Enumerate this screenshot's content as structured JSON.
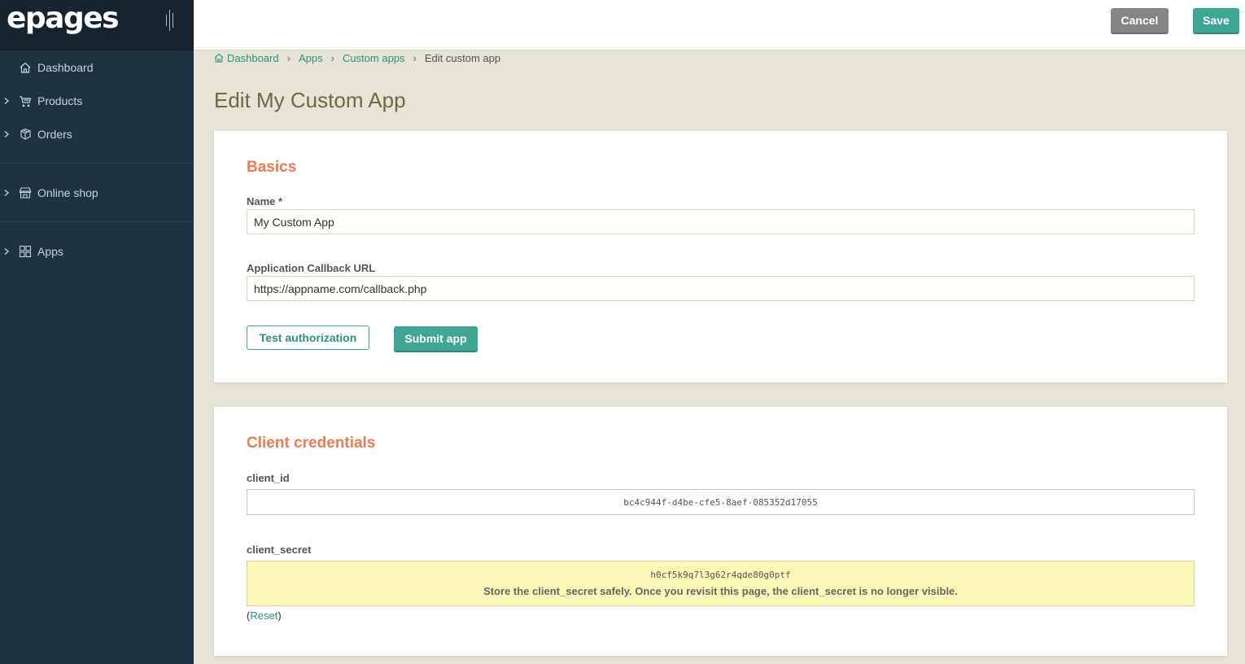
{
  "brand": {
    "logo": "epages"
  },
  "sidebar": {
    "items": [
      {
        "label": "Dashboard",
        "icon": "home-icon",
        "expandable": false
      },
      {
        "label": "Products",
        "icon": "cart-icon",
        "expandable": true
      },
      {
        "label": "Orders",
        "icon": "orders-icon",
        "expandable": true
      },
      {
        "label": "Online shop",
        "icon": "store-icon",
        "expandable": true
      },
      {
        "label": "Apps",
        "icon": "apps-grid-icon",
        "expandable": true
      }
    ]
  },
  "header": {
    "cancel_label": "Cancel",
    "save_label": "Save"
  },
  "breadcrumb": {
    "items": [
      "Dashboard",
      "Apps",
      "Custom apps"
    ],
    "current": "Edit custom app"
  },
  "page": {
    "title": "Edit My Custom App"
  },
  "basics": {
    "title": "Basics",
    "name_label": "Name *",
    "name_value": "My Custom App",
    "callback_label": "Application Callback URL",
    "callback_value": "https://appname.com/callback.php",
    "test_label": "Test authorization",
    "submit_label": "Submit app"
  },
  "credentials": {
    "title": "Client credentials",
    "client_id_label": "client_id",
    "client_id_value": "bc4c944f-d4be-cfe5-8aef-085352d17055",
    "client_secret_label": "client_secret",
    "client_secret_value": "h0cf5k9q7l3g62r4qde80g0ptf",
    "secret_note": "Store the client_secret safely. Once you revisit this page, the client_secret is no longer visible.",
    "reset_open": "(",
    "reset_label": "Reset",
    "reset_close": ")"
  },
  "colors": {
    "sidebar_bg": "#1d3341",
    "accent_teal": "#3fa595",
    "section_title": "#ec7a52",
    "secret_bg": "#fbf8b7"
  }
}
